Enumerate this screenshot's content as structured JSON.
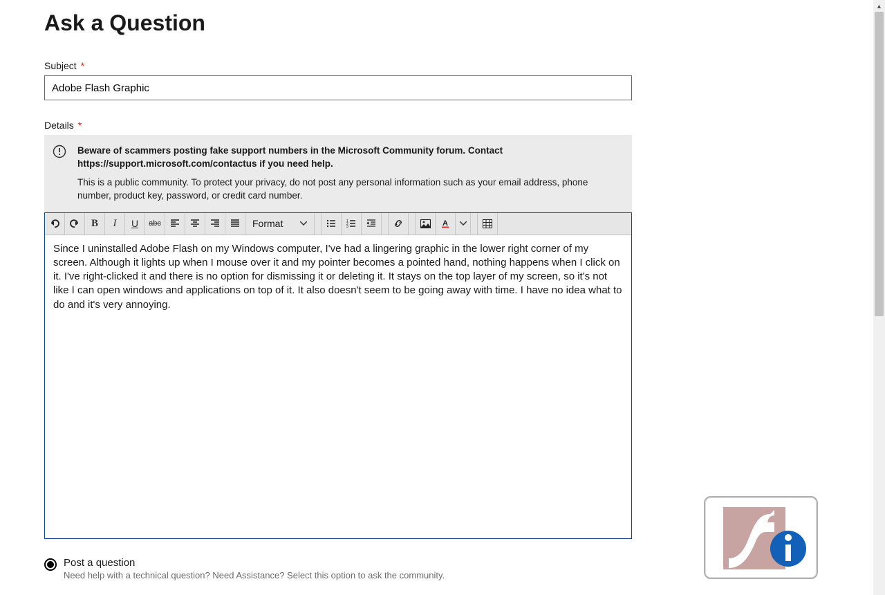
{
  "page": {
    "title": "Ask a Question"
  },
  "subject": {
    "label": "Subject",
    "required": "*",
    "value": "Adobe Flash Graphic"
  },
  "details": {
    "label": "Details",
    "required": "*"
  },
  "warning": {
    "line1": "Beware of scammers posting fake support numbers in the Microsoft Community forum. Contact https://support.microsoft.com/contactus if you need help.",
    "line2": "This is a public community. To protect your privacy, do not post any personal information such as your email address, phone number, product key, password, or credit card number."
  },
  "toolbar": {
    "format_label": "Format"
  },
  "body": {
    "text": "Since I uninstalled Adobe Flash on my Windows computer, I've had a lingering graphic in the lower right corner of my screen. Although it lights up when I mouse over it and my pointer becomes a pointed hand, nothing happens when I click on it. I've right-clicked it and there is no option for dismissing it or deleting it. It stays on the top layer of my screen, so it's not like I can open windows and applications on top of it. It also doesn't seem to be going away with time. I have no idea what to do and it's very annoying."
  },
  "post_type": {
    "option1_label": "Post a question",
    "option1_sub": "Need help with a technical question? Need Assistance? Select this option to ask the community."
  }
}
